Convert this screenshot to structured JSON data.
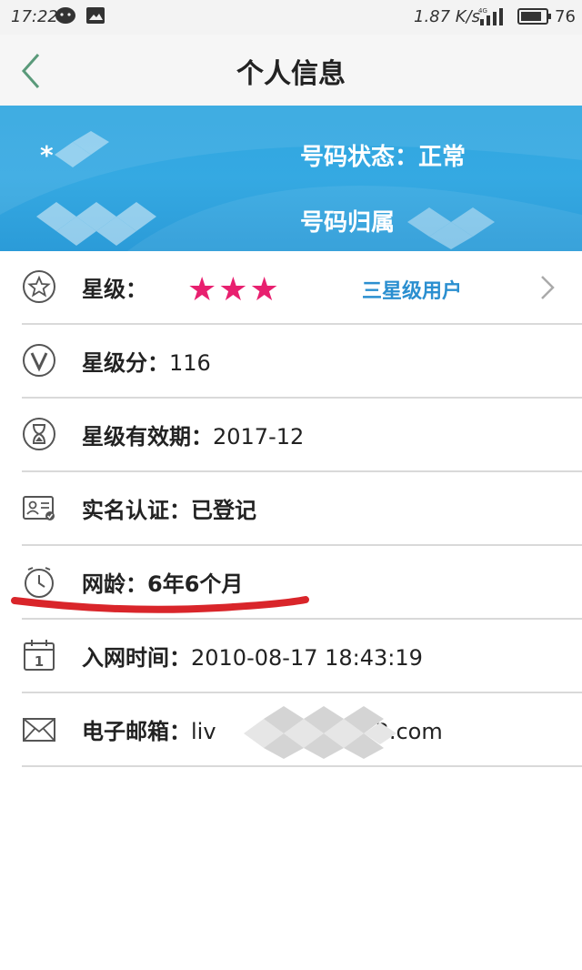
{
  "status_bar": {
    "time": "17:22",
    "speed": "1.87 K/s",
    "network": "4G",
    "battery": "76",
    "icons": [
      "wechat-icon",
      "image-notification-icon",
      "signal-icon",
      "battery-icon"
    ]
  },
  "header": {
    "title": "个人信息",
    "back_icon": "chevron-left-icon"
  },
  "banner": {
    "masked_name": "*",
    "status_label": "号码状态：正常",
    "location_label": "号码归属"
  },
  "rows": [
    {
      "icon": "star-outline-icon",
      "label": "星级：",
      "stars": "★★★",
      "star_level": "三星级用户",
      "chevron": "chevron-right-icon"
    },
    {
      "icon": "v-circle-icon",
      "label": "星级分：",
      "value": "116"
    },
    {
      "icon": "hourglass-icon",
      "label": "星级有效期：",
      "value": "2017-12"
    },
    {
      "icon": "id-card-icon",
      "label": "实名认证：",
      "value": "已登记"
    },
    {
      "icon": "clock-icon",
      "label": "网龄：",
      "value": "6年6个月"
    },
    {
      "icon": "calendar-icon",
      "label": "入网时间：",
      "value": "2010-08-17  18:43:19"
    },
    {
      "icon": "mail-icon",
      "label": "电子邮箱：",
      "value_prefix": "liv",
      "value_suffix": "3.com"
    }
  ],
  "colors": {
    "accent_blue": "#2fa6e0",
    "star_pink": "#e8206f",
    "star_level_blue": "#2b8fd0",
    "annotation_red": "#d9252a"
  }
}
